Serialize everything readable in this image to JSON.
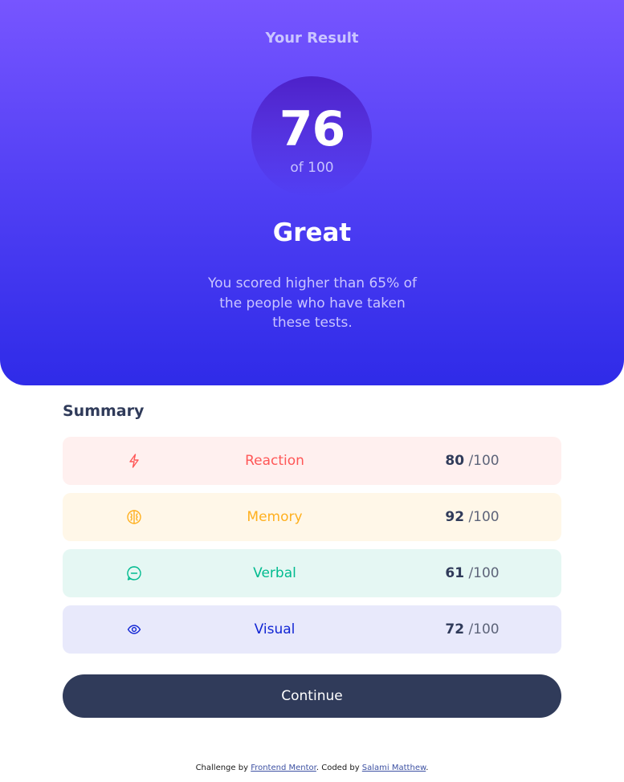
{
  "result": {
    "title": "Your Result",
    "score": "76",
    "score_of": "of 100",
    "rating": "Great",
    "description": "You scored higher than 65% of the people who have taken these tests."
  },
  "summary": {
    "title": "Summary",
    "items": [
      {
        "label": "Reaction",
        "score": "80",
        "max": "/100",
        "icon": "lightning-icon",
        "color": "#ff5757",
        "bg": "#fff0ef"
      },
      {
        "label": "Memory",
        "score": "92",
        "max": "/100",
        "icon": "brain-icon",
        "color": "#ffb01f",
        "bg": "#fff7e8"
      },
      {
        "label": "Verbal",
        "score": "61",
        "max": "/100",
        "icon": "chat-bubble-icon",
        "color": "#00bb8f",
        "bg": "#e5f7f3"
      },
      {
        "label": "Visual",
        "score": "72",
        "max": "/100",
        "icon": "eye-icon",
        "color": "#1125d4",
        "bg": "#e8e9fb"
      }
    ]
  },
  "continue_label": "Continue",
  "footer": {
    "prefix": "Challenge by ",
    "challenge_link": "Frontend Mentor",
    "middle": ". Coded by ",
    "author_link": "Salami Matthew",
    "suffix": "."
  },
  "colors": {
    "gradient_top": "#7755ff",
    "gradient_bottom": "#2f2be8",
    "dark_navy": "#303b5a"
  }
}
